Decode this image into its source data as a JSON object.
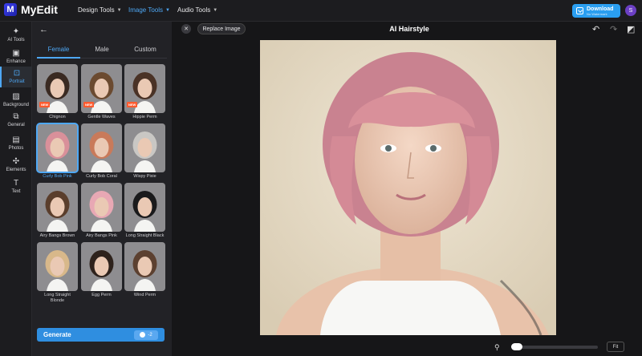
{
  "app": {
    "logo_letter": "M",
    "name": "MyEdit"
  },
  "nav": [
    {
      "label": "Design Tools"
    },
    {
      "label": "Image Tools"
    },
    {
      "label": "Audio Tools"
    }
  ],
  "download": {
    "label": "Download",
    "sub": "No Watermark"
  },
  "user": {
    "initial": "S"
  },
  "rail": [
    {
      "label": "AI Tools",
      "icon": "magic-wand-icon"
    },
    {
      "label": "Enhance",
      "icon": "image-enhance-icon"
    },
    {
      "label": "Portrait",
      "icon": "portrait-icon"
    },
    {
      "label": "Background",
      "icon": "background-icon"
    },
    {
      "label": "General",
      "icon": "crop-icon"
    },
    {
      "label": "Photos",
      "icon": "photos-icon"
    },
    {
      "label": "Elements",
      "icon": "elements-icon"
    },
    {
      "label": "Text",
      "icon": "text-icon"
    }
  ],
  "panel": {
    "tabs": [
      {
        "label": "Female"
      },
      {
        "label": "Male"
      },
      {
        "label": "Custom"
      }
    ],
    "styles": [
      {
        "label": "Chignon",
        "badge": "NEW",
        "hair": "#3a2a22"
      },
      {
        "label": "Gentle Waves",
        "badge": "NEW",
        "hair": "#6b4a30"
      },
      {
        "label": "Hippie Perm",
        "badge": "NEW",
        "hair": "#4a3226"
      },
      {
        "label": "Curly Bob Pink",
        "hair": "#d9909a"
      },
      {
        "label": "Curly Bob Coral",
        "hair": "#c97a5a"
      },
      {
        "label": "Wispy Pixie",
        "hair": "#c9c7c4"
      },
      {
        "label": "Airy Bangs Brown",
        "hair": "#5a3e2c"
      },
      {
        "label": "Airy Bangs Pink",
        "hair": "#e8a8b4"
      },
      {
        "label": "Long Straight Black",
        "hair": "#1a1a1c"
      },
      {
        "label": "Long Straight Blonde",
        "hair": "#d8b88a"
      },
      {
        "label": "Egg Perm",
        "hair": "#2e221c"
      },
      {
        "label": "Wind Perm",
        "hair": "#5c4030"
      }
    ],
    "generate": {
      "label": "Generate",
      "cost": "-2"
    }
  },
  "editor": {
    "title": "AI Hairstyle",
    "replace_label": "Replace Image",
    "fit_label": "Fit",
    "zoom": 0.0
  },
  "colors": {
    "accent": "#4ea8f5",
    "button": "#2f8ee0",
    "hair": "#d9909a"
  }
}
